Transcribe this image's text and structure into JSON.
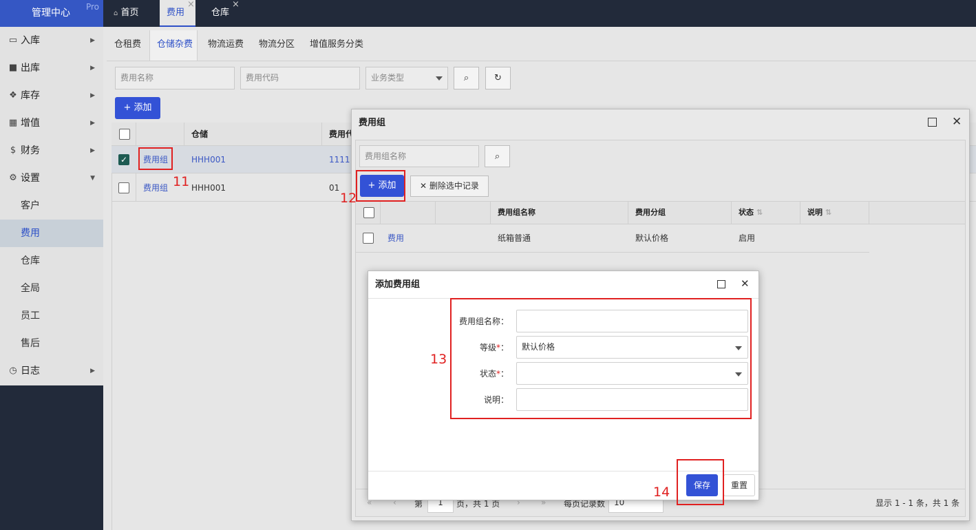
{
  "app": {
    "title": "管理中心",
    "edition": "Pro"
  },
  "top_tabs": [
    {
      "label": "首页",
      "icon": "home-icon"
    },
    {
      "label": "费用",
      "active": true
    },
    {
      "label": "仓库"
    }
  ],
  "sidebar": {
    "items": [
      {
        "label": "入库",
        "icon": "inbox-icon"
      },
      {
        "label": "出库",
        "icon": "truck-icon"
      },
      {
        "label": "库存",
        "icon": "cubes-icon"
      },
      {
        "label": "增值",
        "icon": "grid-icon"
      },
      {
        "label": "财务",
        "icon": "dollar-icon"
      },
      {
        "label": "设置",
        "icon": "gears-icon",
        "expanded": true
      },
      {
        "label": "日志",
        "icon": "clock-icon"
      }
    ],
    "settings_sub": [
      "客户",
      "费用",
      "仓库",
      "全局",
      "员工",
      "售后"
    ],
    "active_sub": "费用"
  },
  "sub_tabs": [
    "仓租费",
    "仓储杂费",
    "物流运费",
    "物流分区",
    "增值服务分类"
  ],
  "active_sub_tab": "仓储杂费",
  "filters": {
    "name_placeholder": "费用名称",
    "code_placeholder": "费用代码",
    "type_placeholder": "业务类型"
  },
  "add_label": "添加",
  "main_table": {
    "columns": [
      "仓储",
      "费用代"
    ],
    "rows": [
      {
        "link": "费用组",
        "warehouse": "HHH001",
        "code": "1111",
        "checked": true
      },
      {
        "link": "费用组",
        "warehouse": "HHH001",
        "code": "01",
        "checked": false
      }
    ]
  },
  "fee_group_dialog": {
    "title": "费用组",
    "search_placeholder": "费用组名称",
    "add_label": "添加",
    "delete_label": "删除选中记录",
    "columns": [
      "费用组名称",
      "费用分组",
      "状态",
      "说明"
    ],
    "rows": [
      {
        "link": "费用",
        "name": "纸箱普通",
        "group": "默认价格",
        "status": "启用",
        "note": ""
      }
    ],
    "pager": {
      "prefix": "第",
      "page": "1",
      "suffix": "页，共 1 页",
      "per_page_label": "每页记录数",
      "per_page": "10",
      "summary": "显示 1 - 1 条，共 1 条"
    }
  },
  "add_dialog": {
    "title": "添加费用组",
    "fields": [
      {
        "label": "费用组名称：",
        "value": "",
        "required": false
      },
      {
        "label": "等级",
        "value": "默认价格",
        "required": true
      },
      {
        "label": "状态",
        "value": "",
        "required": true
      },
      {
        "label": "说明：",
        "value": "",
        "required": false
      }
    ],
    "required_mark": "*",
    "colon": "：",
    "save_label": "保存",
    "reset_label": "重置"
  },
  "annotations": [
    "11",
    "12",
    "13",
    "14"
  ],
  "colors": {
    "accent": "#3352d6",
    "annotation": "#e02020",
    "sidebar_dark": "#222a3a"
  }
}
